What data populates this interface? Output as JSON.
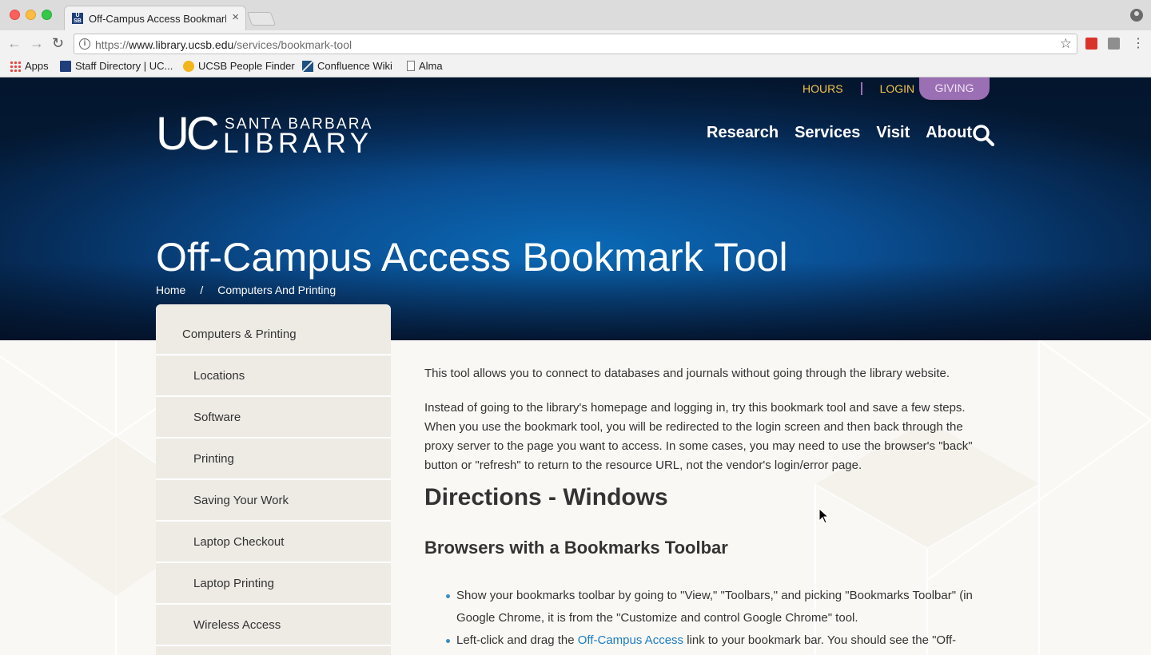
{
  "browser": {
    "tab_title": "Off-Campus Access Bookmark Tool",
    "tab_close": "×",
    "url_prefix": "https://",
    "url_host": "www.library.ucsb.edu",
    "url_path": "/services/bookmark-tool",
    "bookmarks": [
      {
        "label": "Apps",
        "icon": "apps-icon"
      },
      {
        "label": "Staff Directory | UC...",
        "icon": "ucsb-icon"
      },
      {
        "label": "UCSB People Finder",
        "icon": "people-finder-icon"
      },
      {
        "label": "Confluence Wiki",
        "icon": "confluence-icon"
      },
      {
        "label": "Alma",
        "icon": "page-icon"
      }
    ]
  },
  "header": {
    "utility": {
      "hours": "HOURS",
      "login": "LOGIN",
      "giving": "GIVING"
    },
    "logo": {
      "uc": "UC",
      "line1": "SANTA BARBARA",
      "line2": "LIBRARY"
    },
    "nav": [
      "Research",
      "Services",
      "Visit",
      "About"
    ],
    "page_title": "Off-Campus Access Bookmark Tool",
    "breadcrumb": {
      "home": "Home",
      "separator": "/",
      "current": "Computers And Printing"
    }
  },
  "sidebar": {
    "items": [
      "Computers & Printing",
      "Locations",
      "Software",
      "Printing",
      "Saving Your Work",
      "Laptop Checkout",
      "Laptop Printing",
      "Wireless Access"
    ]
  },
  "article": {
    "intro": "This tool allows you to connect to databases and journals without going through the library website.",
    "paragraph": "Instead of going to the library's homepage and logging in, try this bookmark tool and save a few steps. When you use the bookmark tool, you will be redirected to the login screen and then back through the proxy server to the page you want to access. In some cases, you may need to use the browser's \"back\" button or \"refresh\" to return to the resource URL, not the vendor's login/error page.",
    "heading": "Directions - Windows",
    "subheading": "Browsers with a Bookmarks Toolbar",
    "bullet1": "Show your bookmarks toolbar by going to \"View,\" \"Toolbars,\" and picking \"Bookmarks Toolbar\" (in Google Chrome, it is from the \"Customize and control Google Chrome\" tool.",
    "bullet2_before": "Left-click and drag the ",
    "bullet2_link": "Off-Campus Access",
    "bullet2_after": " link to your bookmark bar. You should see the \"Off-"
  },
  "colors": {
    "gold": "#f0c44a",
    "purple": "#9b6fb3",
    "navy": "#062f5e",
    "link": "#1a7cc1"
  }
}
